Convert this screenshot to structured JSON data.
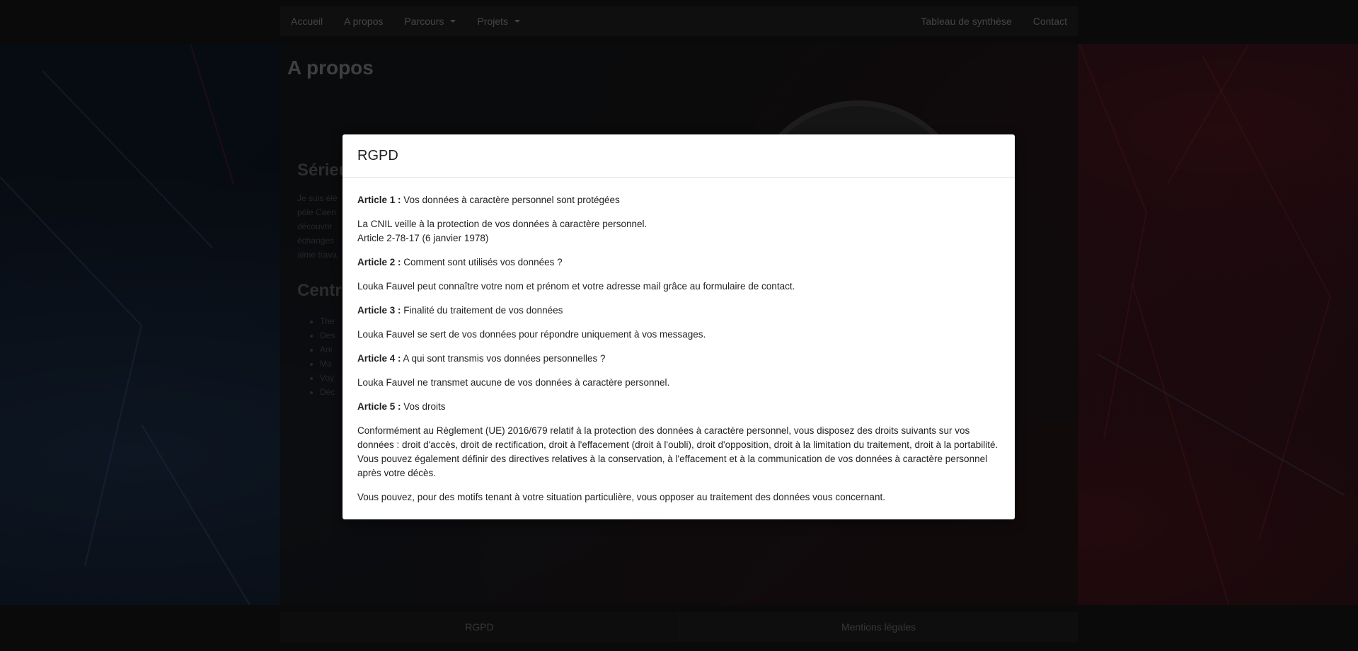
{
  "nav": {
    "left": [
      {
        "label": "Accueil",
        "dropdown": false
      },
      {
        "label": "A propos",
        "dropdown": false
      },
      {
        "label": "Parcours",
        "dropdown": true
      },
      {
        "label": "Projets",
        "dropdown": true
      }
    ],
    "right": [
      {
        "label": "Tableau de synthèse"
      },
      {
        "label": "Contact"
      }
    ]
  },
  "page": {
    "title": "A propos",
    "section1_heading": "Sérieu",
    "section1_text": [
      "Je suis élè",
      "pôle Caen",
      "découvrir",
      "échanges",
      "aime trava"
    ],
    "section2_heading": "Centr",
    "bullets": [
      "The",
      "Des",
      "Ani",
      "Ma",
      "Voy",
      "Déc"
    ]
  },
  "footer": {
    "rgpd": "RGPD",
    "mentions": "Mentions légales"
  },
  "modal": {
    "title": "RGPD",
    "art1_label": "Article 1 :",
    "art1_title": " Vos données à caractère personnel sont protégées",
    "art1_line1": "La CNIL veille à la protection de vos données à caractère personnel.",
    "art1_line2": "Article 2-78-17 (6 janvier 1978)",
    "art2_label": "Article 2 :",
    "art2_title": " Comment sont utilisés vos données ?",
    "art2_text": "Louka Fauvel peut connaître votre nom et prénom et votre adresse mail grâce au formulaire de contact.",
    "art3_label": "Article 3 :",
    "art3_title": " Finalité du traitement de vos données",
    "art3_text": "Louka Fauvel se sert de vos données pour répondre uniquement à vos messages.",
    "art4_label": "Article 4 :",
    "art4_title": " A qui sont transmis vos données personnelles ?",
    "art4_text": "Louka Fauvel ne transmet aucune de vos données à caractère personnel.",
    "art5_label": "Article 5 :",
    "art5_title": " Vos droits",
    "art5_text1": "Conformément au Règlement (UE) 2016/679 relatif à la protection des données à caractère personnel, vous disposez des droits suivants sur vos données : droit d'accès, droit de rectification, droit à l'effacement (droit à l'oubli), droit d'opposition, droit à la limitation du traitement, droit à la portabilité. Vous pouvez également définir des directives relatives à la conservation, à l'effacement et à la communication de vos données à caractère personnel après votre décès.",
    "art5_text2": "Vous pouvez, pour des motifs tenant à votre situation particulière, vous opposer au traitement des données vous concernant."
  }
}
